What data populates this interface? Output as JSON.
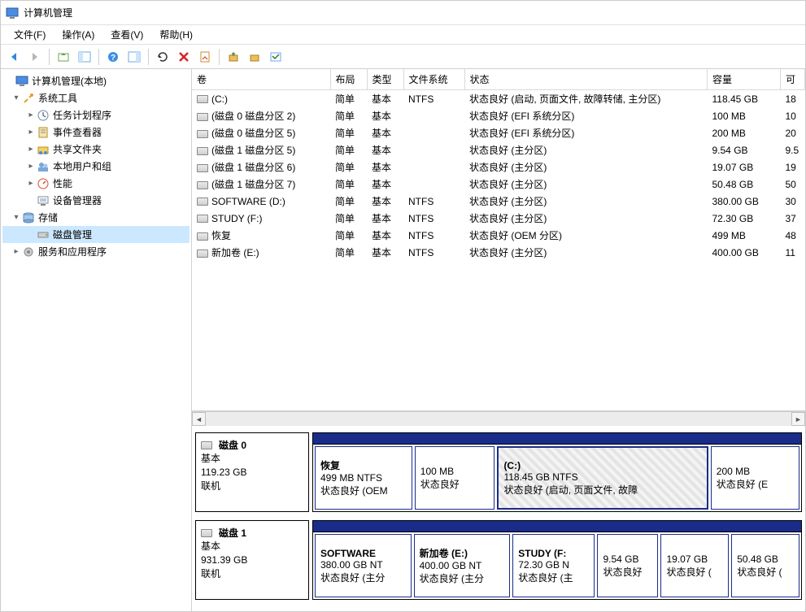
{
  "titlebar": {
    "title": "计算机管理"
  },
  "menu": {
    "file": "文件(F)",
    "action": "操作(A)",
    "view": "查看(V)",
    "help": "帮助(H)"
  },
  "tree": {
    "root": "计算机管理(本地)",
    "sys_tools": "系统工具",
    "task_scheduler": "任务计划程序",
    "event_viewer": "事件查看器",
    "shared_folders": "共享文件夹",
    "local_users": "本地用户和组",
    "performance": "性能",
    "device_manager": "设备管理器",
    "storage": "存储",
    "disk_mgmt": "磁盘管理",
    "services_apps": "服务和应用程序"
  },
  "columns": {
    "volume": "卷",
    "layout": "布局",
    "type": "类型",
    "fs": "文件系统",
    "status": "状态",
    "capacity": "容量",
    "free": "可"
  },
  "volumes": [
    {
      "name": "(C:)",
      "layout": "简单",
      "type": "基本",
      "fs": "NTFS",
      "status": "状态良好 (启动, 页面文件, 故障转储, 主分区)",
      "capacity": "118.45 GB",
      "free": "18"
    },
    {
      "name": "(磁盘 0 磁盘分区 2)",
      "layout": "简单",
      "type": "基本",
      "fs": "",
      "status": "状态良好 (EFI 系统分区)",
      "capacity": "100 MB",
      "free": "10"
    },
    {
      "name": "(磁盘 0 磁盘分区 5)",
      "layout": "简单",
      "type": "基本",
      "fs": "",
      "status": "状态良好 (EFI 系统分区)",
      "capacity": "200 MB",
      "free": "20"
    },
    {
      "name": "(磁盘 1 磁盘分区 5)",
      "layout": "简单",
      "type": "基本",
      "fs": "",
      "status": "状态良好 (主分区)",
      "capacity": "9.54 GB",
      "free": "9.5"
    },
    {
      "name": "(磁盘 1 磁盘分区 6)",
      "layout": "简单",
      "type": "基本",
      "fs": "",
      "status": "状态良好 (主分区)",
      "capacity": "19.07 GB",
      "free": "19"
    },
    {
      "name": "(磁盘 1 磁盘分区 7)",
      "layout": "简单",
      "type": "基本",
      "fs": "",
      "status": "状态良好 (主分区)",
      "capacity": "50.48 GB",
      "free": "50"
    },
    {
      "name": "SOFTWARE (D:)",
      "layout": "简单",
      "type": "基本",
      "fs": "NTFS",
      "status": "状态良好 (主分区)",
      "capacity": "380.00 GB",
      "free": "30"
    },
    {
      "name": "STUDY (F:)",
      "layout": "简单",
      "type": "基本",
      "fs": "NTFS",
      "status": "状态良好 (主分区)",
      "capacity": "72.30 GB",
      "free": "37"
    },
    {
      "name": "恢复",
      "layout": "简单",
      "type": "基本",
      "fs": "NTFS",
      "status": "状态良好 (OEM 分区)",
      "capacity": "499 MB",
      "free": "48"
    },
    {
      "name": "新加卷 (E:)",
      "layout": "简单",
      "type": "基本",
      "fs": "NTFS",
      "status": "状态良好 (主分区)",
      "capacity": "400.00 GB",
      "free": "11"
    }
  ],
  "disks": [
    {
      "name": "磁盘 0",
      "type": "基本",
      "size": "119.23 GB",
      "state": "联机",
      "parts": [
        {
          "name": "恢复",
          "line2": "499 MB NTFS",
          "status": "状态良好 (OEM",
          "flex": "1.0",
          "active": false
        },
        {
          "name": "",
          "line2": "100 MB",
          "status": "状态良好",
          "flex": "0.8",
          "active": false
        },
        {
          "name": "(C:)",
          "line2": "118.45 GB NTFS",
          "status": "状态良好 (启动, 页面文件, 故障",
          "flex": "2.3",
          "active": true
        },
        {
          "name": "",
          "line2": "200 MB",
          "status": "状态良好 (E",
          "flex": "0.9",
          "active": false
        }
      ]
    },
    {
      "name": "磁盘 1",
      "type": "基本",
      "size": "931.39 GB",
      "state": "联机",
      "parts": [
        {
          "name": "SOFTWARE",
          "line2": "380.00 GB NT",
          "status": "状态良好 (主分",
          "flex": "1.2",
          "active": false
        },
        {
          "name": "新加卷  (E:)",
          "line2": "400.00 GB NT",
          "status": "状态良好 (主分",
          "flex": "1.2",
          "active": false
        },
        {
          "name": "STUDY  (F:",
          "line2": "72.30 GB N",
          "status": "状态良好 (主",
          "flex": "1.0",
          "active": false
        },
        {
          "name": "",
          "line2": "9.54 GB",
          "status": "状态良好",
          "flex": "0.7",
          "active": false
        },
        {
          "name": "",
          "line2": "19.07 GB",
          "status": "状态良好 (",
          "flex": "0.8",
          "active": false
        },
        {
          "name": "",
          "line2": "50.48 GB",
          "status": "状态良好 (",
          "flex": "0.8",
          "active": false
        }
      ]
    }
  ]
}
